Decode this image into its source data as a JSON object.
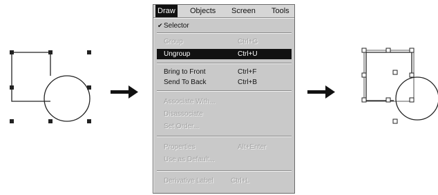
{
  "menubar": {
    "titles": [
      "Draw",
      "Objects",
      "Screen",
      "Tools"
    ],
    "active_index": 0
  },
  "menu": {
    "items": [
      {
        "label": "Selector",
        "shortcut": "",
        "checked": true,
        "enabled": true,
        "highlighted": false
      },
      {
        "label": "Group",
        "shortcut": "Ctrl+G",
        "checked": false,
        "enabled": false,
        "highlighted": false
      },
      {
        "label": "Ungroup",
        "shortcut": "Ctrl+U",
        "checked": false,
        "enabled": true,
        "highlighted": true
      },
      {
        "label": "Bring to Front",
        "shortcut": "Ctrl+F",
        "checked": false,
        "enabled": true,
        "highlighted": false
      },
      {
        "label": "Send To Back",
        "shortcut": "Ctrl+B",
        "checked": false,
        "enabled": true,
        "highlighted": false
      },
      {
        "label": "Associate With...",
        "shortcut": "",
        "checked": false,
        "enabled": false,
        "highlighted": false
      },
      {
        "label": "Disassociate",
        "shortcut": "",
        "checked": false,
        "enabled": false,
        "highlighted": false
      },
      {
        "label": "Set Order...",
        "shortcut": "",
        "checked": false,
        "enabled": false,
        "highlighted": false
      },
      {
        "label": "Properties",
        "shortcut": "Alt+Enter",
        "checked": false,
        "enabled": false,
        "highlighted": false
      },
      {
        "label": "Use as Default...",
        "shortcut": "",
        "checked": false,
        "enabled": false,
        "highlighted": false
      },
      {
        "label": "Derivative Label",
        "shortcut": "Ctrl+L",
        "checked": false,
        "enabled": false,
        "highlighted": false
      }
    ]
  },
  "colors": {
    "menu_bg": "#c9c9c9",
    "highlight_bg": "#111111",
    "disabled_text": "#a3a3a3",
    "line": "#222222"
  },
  "icons": {
    "arrow_left": "right-arrow-icon",
    "arrow_right": "right-arrow-icon"
  }
}
